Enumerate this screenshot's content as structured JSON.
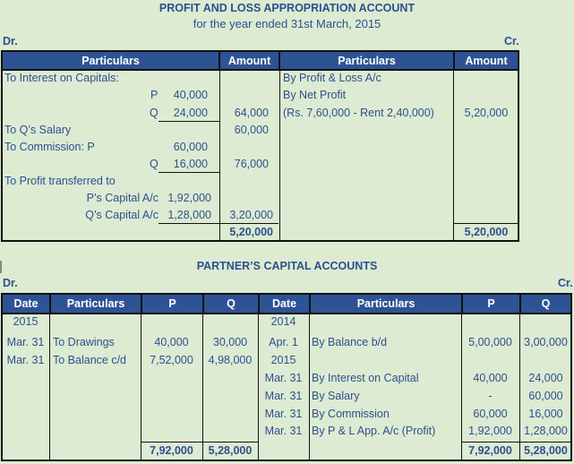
{
  "pl": {
    "title": "PROFIT AND LOSS APPROPRIATION  ACCOUNT",
    "subtitle": "for the year ended 31st March, 2015",
    "dr": "Dr.",
    "cr": "Cr.",
    "headers": [
      "Particulars",
      "Amount",
      "Particulars",
      "Amount"
    ],
    "debit": {
      "interest_label": "To Interest on Capitals:",
      "interest_p_label": "P",
      "interest_p": "40,000",
      "interest_q_label": "Q",
      "interest_q": "24,000",
      "interest_total": "64,000",
      "salary_label": "To Q’s Salary",
      "salary_total": "60,000",
      "commission_label": "To Commission: P",
      "commission_p": "60,000",
      "commission_q_label": "Q",
      "commission_q": "16,000",
      "commission_total": "76,000",
      "profit_label": "To Profit transferred to",
      "p_capital_label": "P’s Capital  A/c",
      "p_capital": "1,92,000",
      "q_capital_label": "Q’s Capital  A/c",
      "q_capital": "1,28,000",
      "profit_total": "3,20,000",
      "grand_total": "5,20,000"
    },
    "credit": {
      "line1": "By Profit & Loss A/c",
      "line2": "By Net Profit",
      "line3": "(Rs. 7,60,000  - Rent 2,40,000)",
      "amount": "5,20,000",
      "grand_total": "5,20,000"
    }
  },
  "capital": {
    "title": "PARTNER’S CAPITAL ACCOUNTS",
    "dr": "Dr.",
    "cr": "Cr.",
    "headers": [
      "Date",
      "Particulars",
      "P",
      "Q",
      "Date",
      "Particulars",
      "P",
      "Q"
    ],
    "debit_rows": [
      {
        "date": "2015",
        "particulars": "",
        "p": "",
        "q": ""
      },
      {
        "date": "Mar. 31",
        "particulars": "To Drawings",
        "p": "40,000",
        "q": "30,000"
      },
      {
        "date": "Mar. 31",
        "particulars": " To Balance  c/d",
        "p": "7,52,000",
        "q": "4,98,000"
      }
    ],
    "credit_rows": [
      {
        "date": "2014",
        "particulars": "",
        "p": "",
        "q": ""
      },
      {
        "date": "Apr. 1",
        "particulars": "By Balance  b/d",
        "p": "5,00,000",
        "q": "3,00,000"
      },
      {
        "date": "2015",
        "particulars": "",
        "p": "",
        "q": ""
      },
      {
        "date": "Mar. 31",
        "particulars": "By Interest on Capital",
        "p": "40,000",
        "q": "24,000"
      },
      {
        "date": "Mar. 31",
        "particulars": "By Salary",
        "p": "-",
        "q": "60,000"
      },
      {
        "date": "Mar. 31",
        "particulars": "By Commission",
        "p": "60,000",
        "q": "16,000"
      },
      {
        "date": "Mar. 31",
        "particulars": "By P & L App. A/c (Profit)",
        "p": "1,92,000",
        "q": "1,28,000"
      }
    ],
    "totals": {
      "debit_p": "7,92,000",
      "debit_q": "5,28,000",
      "credit_p": "7,92,000",
      "credit_q": "5,28,000"
    }
  }
}
